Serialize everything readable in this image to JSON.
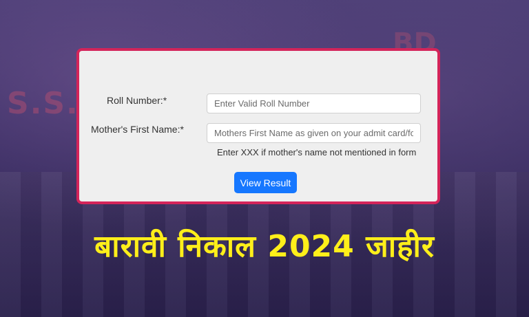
{
  "form": {
    "roll_label": "Roll Number:*",
    "roll_placeholder": "Enter Valid Roll Number",
    "mother_label": "Mother's First Name:*",
    "mother_placeholder": "Mothers First Name as given on your admit card/form",
    "hint": "Enter XXX if mother's name not mentioned in form",
    "submit_label": "View Result"
  },
  "headline": "बारावी निकाल 2024 जाहीर",
  "colors": {
    "card_border": "#d4245a",
    "button": "#1677ff",
    "headline": "#ffef1a",
    "background": "#3a2f63"
  }
}
